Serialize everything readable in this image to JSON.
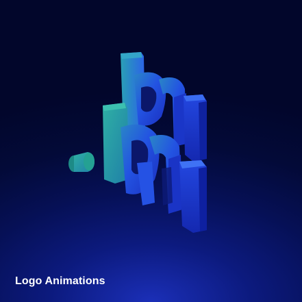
{
  "card": {
    "caption": "Logo Animations",
    "background_colors": [
      "#02062b",
      "#061056",
      "#1b2fb8"
    ]
  },
  "logo": {
    "icon": "3d-extruded-logo-icon",
    "colors": {
      "top_face": "#1f8fae",
      "front_dark": "#1a3ed8",
      "front_light": "#2a5bf0",
      "side": "#1330c4",
      "accent_teal": "#2a9a8f"
    }
  }
}
